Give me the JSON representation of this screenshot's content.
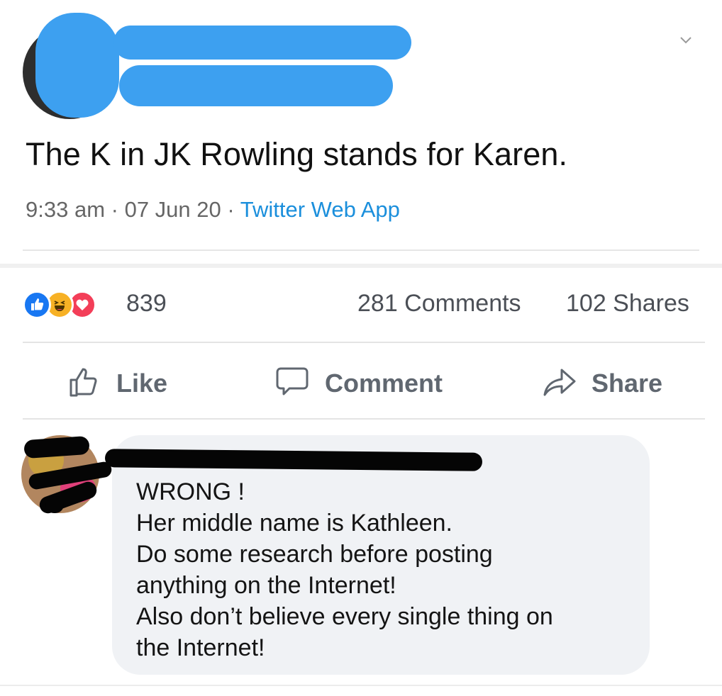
{
  "tweet": {
    "text": "The K in JK Rowling stands for Karen.",
    "time": "9:33 am",
    "separator": " · ",
    "date": "07 Jun 20",
    "source": "Twitter Web App"
  },
  "stats": {
    "reaction_count": "839",
    "reaction_icons": [
      "like-icon",
      "haha-icon",
      "love-icon"
    ],
    "comments": "281 Comments",
    "shares": "102 Shares"
  },
  "actions": {
    "like_label": "Like",
    "comment_label": "Comment",
    "share_label": "Share"
  },
  "comment": {
    "lines": [
      "WRONG !",
      "Her middle name is Kathleen.",
      "Do some research before posting",
      "anything on the Internet!",
      "Also don’t believe every single thing on",
      "the Internet!"
    ]
  },
  "colors": {
    "link": "#1b8fdc",
    "redaction_blue": "#3da0f0",
    "redaction_black": "#050505",
    "like_blue": "#1877f2",
    "haha_yellow": "#f7b125",
    "love_red": "#f33e58",
    "bubble_bg": "#f0f2f5"
  }
}
